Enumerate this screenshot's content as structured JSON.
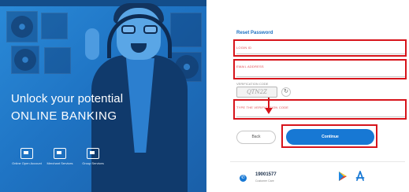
{
  "hero": {
    "brand_strip": "",
    "title": "Unlock your potential",
    "subtitle": "ONLINE BANKING",
    "features": [
      {
        "icon": "wallet-icon",
        "label": "Online Open Account"
      },
      {
        "icon": "document-icon",
        "label": "Merchant Services"
      },
      {
        "icon": "briefcase-icon",
        "label": "Group Services"
      }
    ]
  },
  "form": {
    "title": "Reset Password",
    "login_id_label": "LOGIN ID",
    "email_label": "EMAIL ADDRESS",
    "captcha_label": "VERIFICATION CODE",
    "captcha_value": "QTN2Z",
    "typed_code_label": "TYPE THE VERIFICATION CODE",
    "back_label": "Back",
    "continue_label": "Continue"
  },
  "footer": {
    "phone": "19001577",
    "phone_caption": "Customer Care"
  },
  "colors": {
    "brand_blue": "#1778d4",
    "highlight_red": "#d7141b",
    "label_red": "#e1484f"
  }
}
